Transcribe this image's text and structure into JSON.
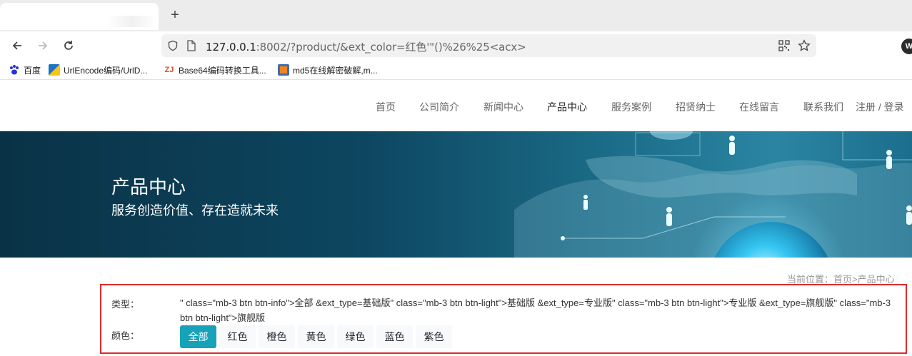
{
  "browser": {
    "url_host": "127.0.0.1",
    "url_rest": ":8002/?product/&ext_color=红色'\"()%26%25<acx>",
    "profile_initial": "W",
    "bookmarks": [
      {
        "label": "百度",
        "icon": "baidu-icon",
        "color": "#2932e1"
      },
      {
        "label": "UrlEncode编码/UrlD...",
        "icon": "urlencode-icon",
        "color": "#1e73be"
      },
      {
        "label": "Base64编码转换工具...",
        "icon": "base64-icon",
        "color": "#e44d26"
      },
      {
        "label": "md5在线解密破解,m...",
        "icon": "md5-icon",
        "color": "#f58220"
      }
    ]
  },
  "site": {
    "nav": [
      "首页",
      "公司简介",
      "新闻中心",
      "产品中心",
      "服务案例",
      "招贤纳士",
      "在线留言",
      "联系我们",
      "注册 / 登录"
    ],
    "active_nav": "产品中心",
    "banner_title": "产品中心",
    "banner_subtitle": "服务创造价值、存在造就未来",
    "breadcrumb": "当前位置：首页>产品中心"
  },
  "filter": {
    "type_label": "类型：",
    "type_text": "\" class=\"mb-3 btn btn-info\">全部 &ext_type=基础版\" class=\"mb-3 btn btn-light\">基础版 &ext_type=专业版\" class=\"mb-3 btn btn-light\">专业版 &ext_type=旗舰版\" class=\"mb-3 btn btn-light\">旗舰版",
    "color_label": "颜色：",
    "colors": [
      "全部",
      "红色",
      "橙色",
      "黄色",
      "绿色",
      "蓝色",
      "紫色"
    ],
    "active_color": "全部"
  },
  "colors": {
    "accent": "#17a2b8",
    "highlight_border": "#e02a2a",
    "banner_dark": "#0a3246"
  }
}
